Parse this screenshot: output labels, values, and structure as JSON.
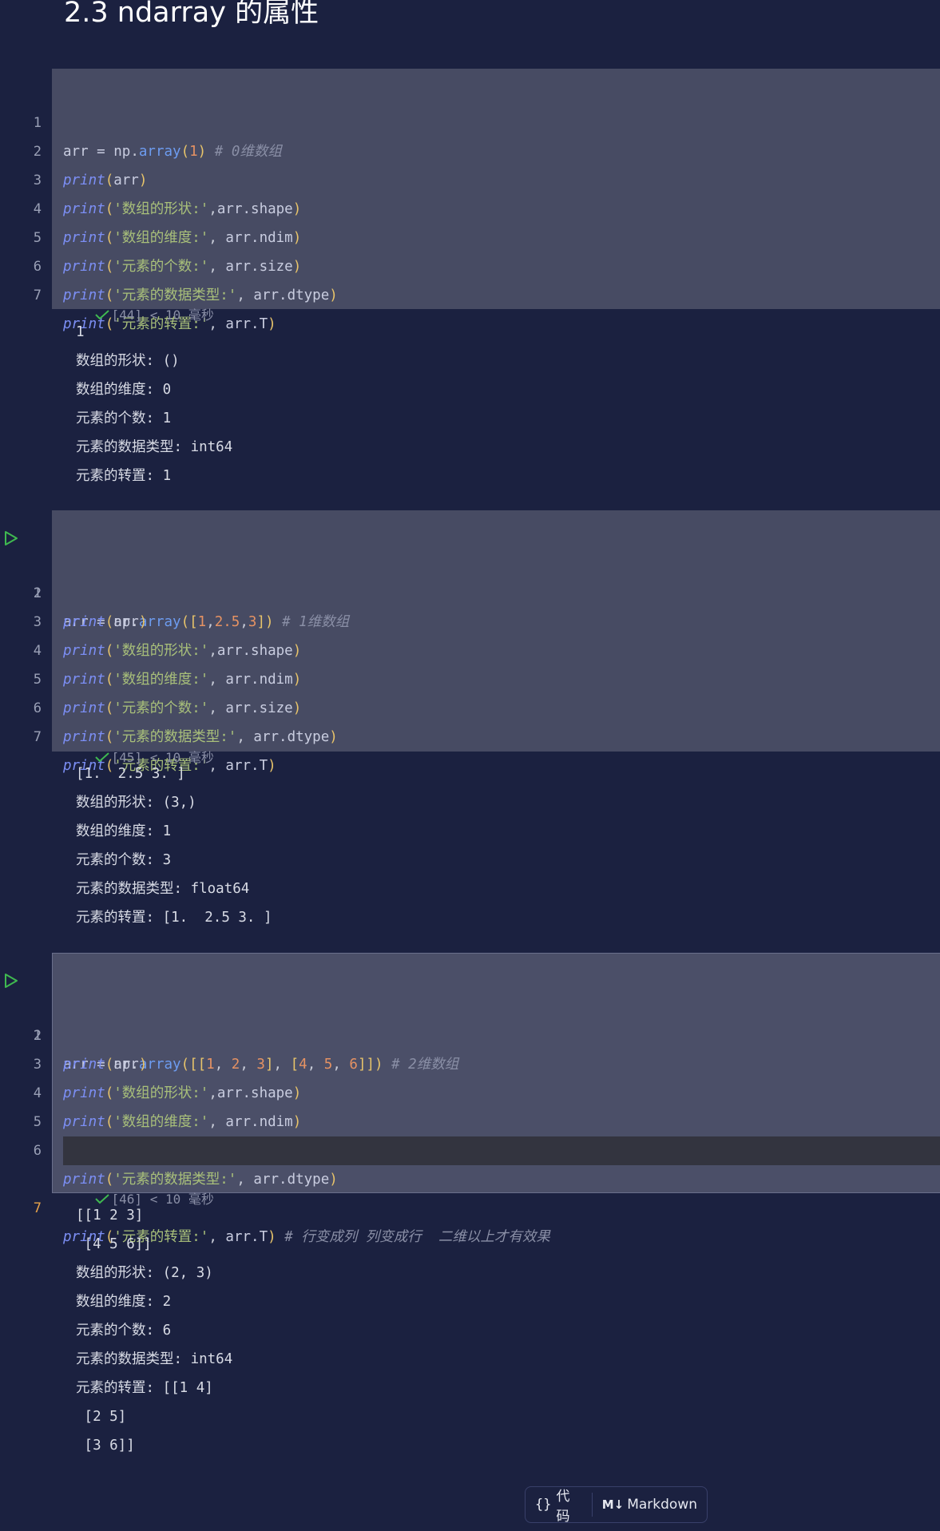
{
  "heading": "2.3 ndarray 的属性",
  "cells": [
    {
      "status": "[44] < 10 毫秒",
      "output": [
        "1",
        "数组的形状: ()",
        "数组的维度: 0",
        "元素的个数: 1",
        "元素的数据类型: int64",
        "元素的转置: 1"
      ]
    },
    {
      "status": "[45] < 10 毫秒",
      "output": [
        "[1.  2.5 3. ]",
        "数组的形状: (3,)",
        "数组的维度: 1",
        "元素的个数: 3",
        "元素的数据类型: float64",
        "元素的转置: [1.  2.5 3. ]"
      ]
    },
    {
      "status": "[46] < 10 毫秒",
      "output": [
        "[[1 2 3]",
        " [4 5 6]]",
        "数组的形状: (2, 3)",
        "数组的维度: 2",
        "元素的个数: 6",
        "元素的数据类型: int64",
        "元素的转置: [[1 4]",
        " [2 5]",
        " [3 6]]"
      ]
    }
  ],
  "line_numbers": [
    "1",
    "2",
    "3",
    "4",
    "5",
    "6",
    "7"
  ],
  "code": {
    "c1_l1_comment": "# 0维数组",
    "c2_l1_comment": "# 1维数组",
    "c3_l1_comment": "# 2维数组",
    "c3_l7_comment": "# 行变成列 列变成行  二维以上才有效果",
    "str_shape": "'数组的形状:'",
    "str_ndim": "'数组的维度:'",
    "str_size": "'元素的个数:'",
    "str_dtype": "'元素的数据类型:'",
    "str_T": "'元素的转置:'"
  },
  "toolbar": {
    "code_label": "代码",
    "markdown_icon": "M↓",
    "markdown_label": "Markdown"
  },
  "icons": {
    "run": "run-triangle-icon",
    "check": "check-icon",
    "braces": "braces-icon"
  },
  "colors": {
    "background": "#1b2140",
    "cell": "#474b63",
    "accent_run": "#3fb950"
  }
}
